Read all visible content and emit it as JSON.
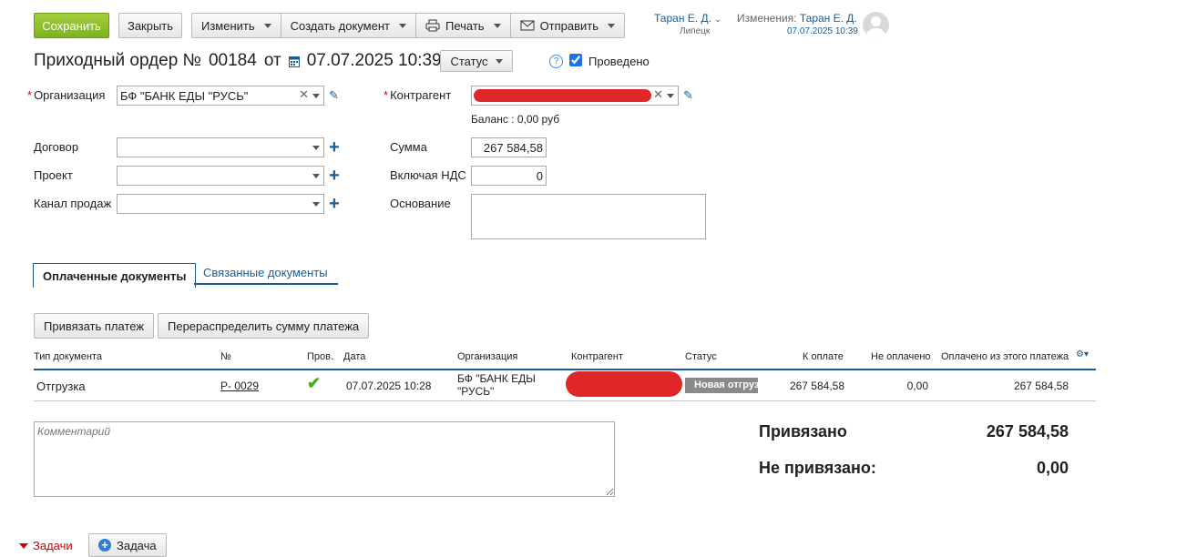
{
  "toolbar": {
    "save": "Сохранить",
    "close": "Закрыть",
    "edit": "Изменить",
    "create": "Создать документ",
    "print": "Печать",
    "send": "Отправить"
  },
  "user": {
    "name": "Таран Е. Д.",
    "city": "Липецк",
    "changes_label": "Изменения:",
    "changes_user": "Таран Е. Д.",
    "changes_date": "07.07.2025 10:39"
  },
  "header": {
    "title": "Приходный ордер №",
    "number": "00184",
    "from": "от",
    "date": "07.07.2025 10:39",
    "status_btn": "Статус",
    "posted_label": "Проведено",
    "posted": true,
    "help": "?"
  },
  "form": {
    "org_label": "Организация",
    "org_value": "БФ \"БАНК ЕДЫ \"РУСЬ\"",
    "contract_label": "Договор",
    "project_label": "Проект",
    "channel_label": "Канал продаж",
    "counterparty_label": "Контрагент",
    "balance": "Баланс : 0,00 руб",
    "sum_label": "Сумма",
    "sum_value": "267 584,58",
    "vat_label": "Включая НДС",
    "vat_value": "0",
    "basis_label": "Основание"
  },
  "tabs": {
    "paid": "Оплаченные документы",
    "linked": "Связанные документы"
  },
  "actions": {
    "bind": "Привязать платеж",
    "redistribute": "Перераспределить сумму платежа"
  },
  "table": {
    "headers": {
      "type": "Тип документа",
      "num": "№",
      "check": "Пров.",
      "date": "Дата",
      "org": "Организация",
      "counterparty": "Контрагент",
      "status": "Статус",
      "to_pay": "К оплате",
      "unpaid": "Не оплачено",
      "paid_from": "Оплачено из этого платежа"
    },
    "rows": [
      {
        "type": "Отгрузка",
        "num": "Р- 0029",
        "date": "07.07.2025 10:28",
        "org_line1": "БФ \"БАНК ЕДЫ",
        "org_line2": "\"РУСЬ\"",
        "status": "Новая отгрузка",
        "to_pay": "267 584,58",
        "unpaid": "0,00",
        "paid_from": "267 584,58"
      }
    ]
  },
  "comment": {
    "placeholder": "Комментарий"
  },
  "totals": {
    "bound_label": "Привязано",
    "bound_value": "267 584,58",
    "unbound_label": "Не привязано:",
    "unbound_value": "0,00"
  },
  "tasks": {
    "label": "Задачи",
    "add": "Задача"
  },
  "colors": {
    "accent": "#1b5d8e",
    "save_green": "#8cc12a",
    "redaction": "#e02727",
    "status_badge": "#8a8a8a",
    "check_green": "#4caf1a"
  }
}
